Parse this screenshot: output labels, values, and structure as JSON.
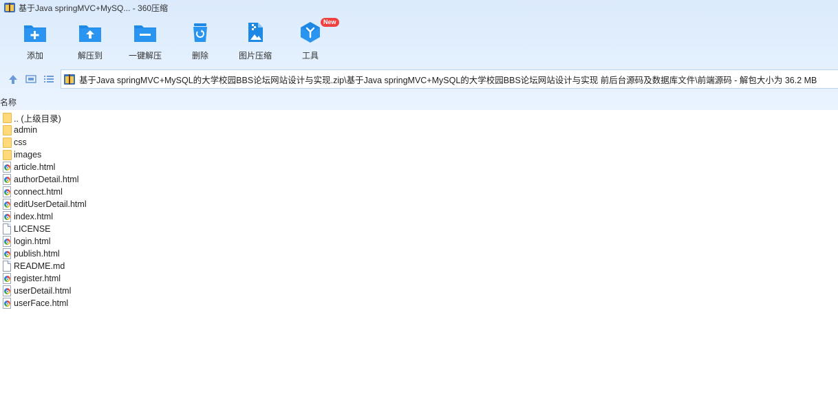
{
  "window": {
    "title": "基于Java springMVC+MySQ... - 360压缩"
  },
  "toolbar": {
    "items": [
      {
        "label": "添加",
        "icon": "add-folder-icon"
      },
      {
        "label": "解压到",
        "icon": "extract-to-icon"
      },
      {
        "label": "一键解压",
        "icon": "one-click-extract-icon"
      },
      {
        "label": "删除",
        "icon": "delete-icon"
      },
      {
        "label": "图片压缩",
        "icon": "image-compress-icon"
      },
      {
        "label": "工具",
        "icon": "tools-icon",
        "badge": "New"
      }
    ]
  },
  "nav": {
    "path": "基于Java springMVC+MySQL的大学校园BBS论坛网站设计与实现.zip\\基于Java springMVC+MySQL的大学校园BBS论坛网站设计与实现 前后台源码及数据库文件\\前端源码 - 解包大小为 36.2 MB"
  },
  "list": {
    "column_name": "名称",
    "items": [
      {
        "name": ".. (上级目录)",
        "type": "folder"
      },
      {
        "name": "admin",
        "type": "folder"
      },
      {
        "name": "css",
        "type": "folder"
      },
      {
        "name": "images",
        "type": "folder"
      },
      {
        "name": "article.html",
        "type": "html"
      },
      {
        "name": "authorDetail.html",
        "type": "html"
      },
      {
        "name": "connect.html",
        "type": "html"
      },
      {
        "name": "editUserDetail.html",
        "type": "html"
      },
      {
        "name": "index.html",
        "type": "html"
      },
      {
        "name": "LICENSE",
        "type": "file"
      },
      {
        "name": "login.html",
        "type": "html"
      },
      {
        "name": "publish.html",
        "type": "html"
      },
      {
        "name": "README.md",
        "type": "file"
      },
      {
        "name": "register.html",
        "type": "html"
      },
      {
        "name": "userDetail.html",
        "type": "html"
      },
      {
        "name": "userFace.html",
        "type": "html"
      }
    ]
  },
  "colors": {
    "accent": "#1e88e5",
    "chrome_bg": "#e4f0fd",
    "badge": "#f04040"
  }
}
